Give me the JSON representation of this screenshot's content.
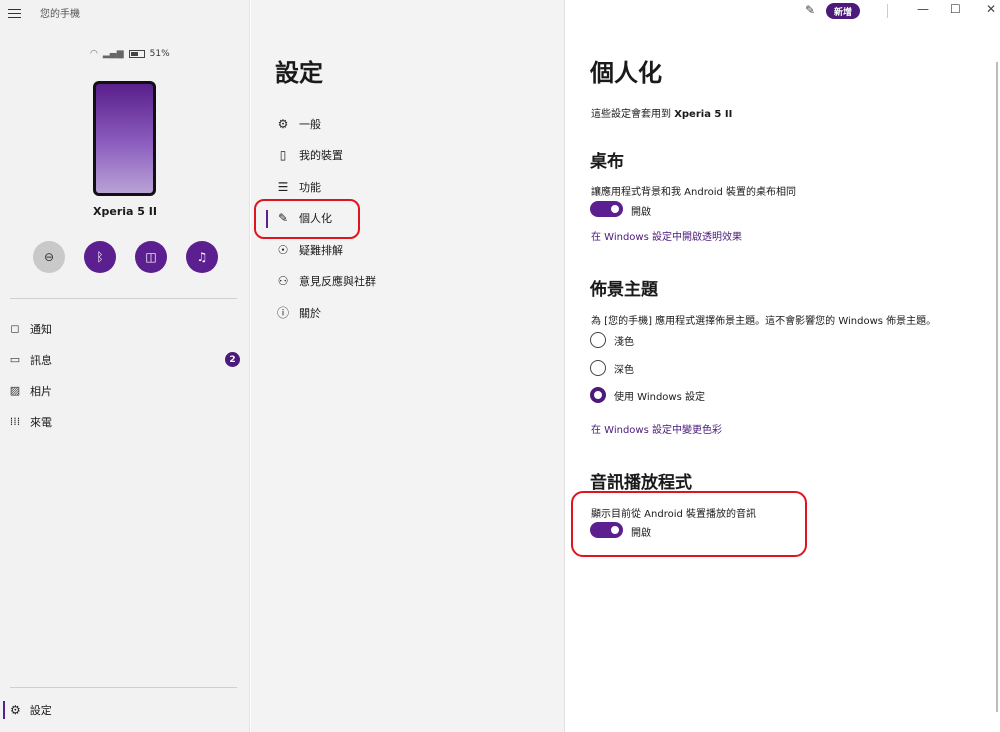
{
  "app": {
    "title": "您的手機"
  },
  "status": {
    "battery": "51%"
  },
  "device": {
    "name": "Xperia 5 II"
  },
  "left_nav": [
    {
      "label": "通知",
      "icon": "bell-icon"
    },
    {
      "label": "訊息",
      "icon": "message-icon",
      "badge": "2"
    },
    {
      "label": "相片",
      "icon": "photo-icon"
    },
    {
      "label": "來電",
      "icon": "dialpad-icon"
    }
  ],
  "left_settings": {
    "label": "設定",
    "icon": "gear-icon"
  },
  "settings_nav": {
    "title": "設定",
    "items": [
      {
        "label": "一般",
        "icon": "gear-icon"
      },
      {
        "label": "我的裝置",
        "icon": "phone-icon"
      },
      {
        "label": "功能",
        "icon": "list-icon"
      },
      {
        "label": "個人化",
        "icon": "personalize-icon",
        "selected": true
      },
      {
        "label": "疑難排解",
        "icon": "troubleshoot-icon"
      },
      {
        "label": "意見反應與社群",
        "icon": "community-icon"
      },
      {
        "label": "關於",
        "icon": "info-icon"
      }
    ]
  },
  "titlebar": {
    "new_label": "新增"
  },
  "content": {
    "title": "個人化",
    "applies_prefix": "這些設定會套用到",
    "applies_device": "Xperia 5 II",
    "wallpaper": {
      "heading": "桌布",
      "description": "讓應用程式背景和我 Android 裝置的桌布相同",
      "toggle_label": "開啟",
      "toggle_on": true,
      "link": "在 Windows 設定中開啟透明效果"
    },
    "theme": {
      "heading": "佈景主題",
      "description": "為 [您的手機] 應用程式選擇佈景主題。這不會影響您的 Windows 佈景主題。",
      "options": [
        {
          "label": "淺色",
          "selected": false
        },
        {
          "label": "深色",
          "selected": false
        },
        {
          "label": "使用 Windows 設定",
          "selected": true
        }
      ],
      "link": "在 Windows 設定中變更色彩"
    },
    "audio": {
      "heading": "音訊播放程式",
      "description": "顯示目前從 Android 裝置播放的音訊",
      "toggle_label": "開啟",
      "toggle_on": true
    }
  },
  "colors": {
    "accent": "#5c1f8f",
    "highlight": "#e0141e"
  }
}
